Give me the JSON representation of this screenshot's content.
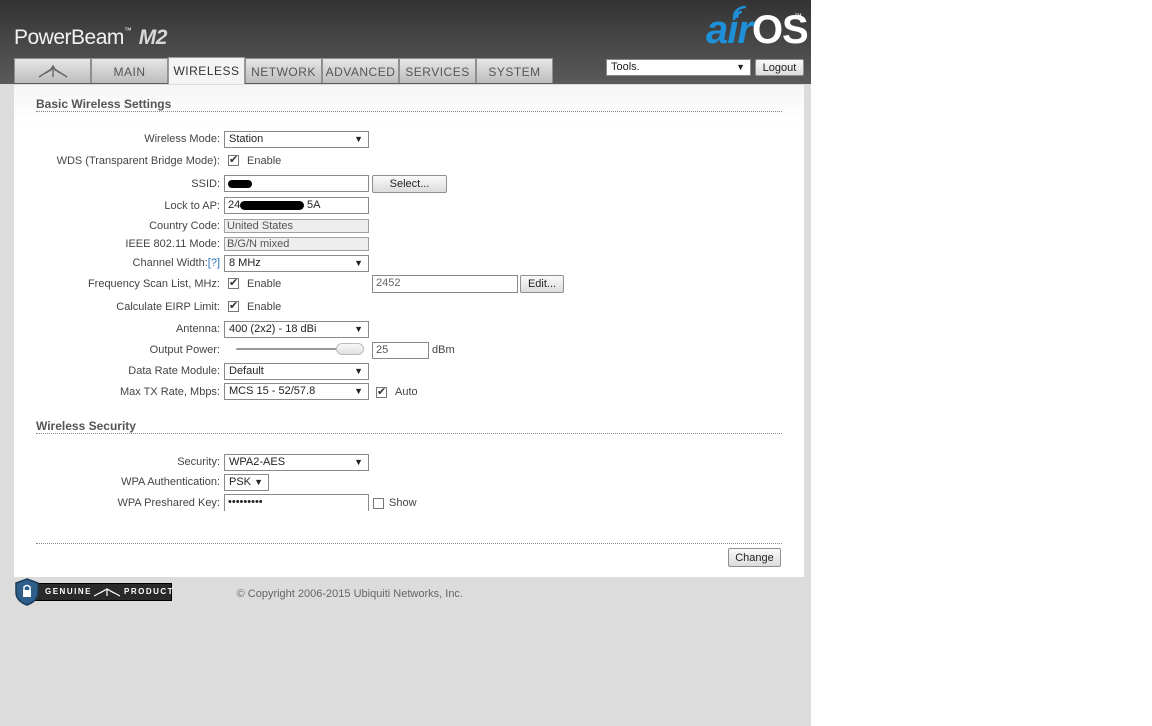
{
  "header": {
    "brand": "PowerBeam",
    "brand_tm": "™",
    "model": "M2",
    "logo_air": "air",
    "logo_os": "OS",
    "logo_tm": "™"
  },
  "tabs": [
    {
      "label": "",
      "icon": "ubiquiti-logo-icon"
    },
    {
      "label": "MAIN"
    },
    {
      "label": "WIRELESS",
      "active": true
    },
    {
      "label": "NETWORK"
    },
    {
      "label": "ADVANCED"
    },
    {
      "label": "SERVICES"
    },
    {
      "label": "SYSTEM"
    }
  ],
  "toolbar": {
    "tools_value": "Tools.",
    "logout_label": "Logout"
  },
  "basic": {
    "title": "Basic Wireless Settings",
    "wireless_mode_label": "Wireless Mode:",
    "wireless_mode_value": "Station",
    "wds_label": "WDS (Transparent Bridge Mode):",
    "wds_enable": "Enable",
    "ssid_label": "SSID:",
    "select_button": "Select...",
    "lock_ap_label": "Lock to AP:",
    "lock_ap_prefix": "24",
    "lock_ap_suffix": "5A",
    "country_label": "Country Code:",
    "country_value": "United States",
    "ieee_label": "IEEE 802.11 Mode:",
    "ieee_value": "B/G/N mixed",
    "channel_width_label": "Channel Width:",
    "channel_width_help": "[?]",
    "channel_width_value": "8 MHz",
    "freq_label": "Frequency Scan List, MHz:",
    "freq_enable": "Enable",
    "freq_value": "2452",
    "edit_button": "Edit...",
    "eirp_label": "Calculate EIRP Limit:",
    "eirp_enable": "Enable",
    "antenna_label": "Antenna:",
    "antenna_value": "400 (2x2) - 18 dBi",
    "output_power_label": "Output Power:",
    "output_power_value": "25",
    "output_power_unit": "dBm",
    "data_rate_label": "Data Rate Module:",
    "data_rate_value": "Default",
    "max_tx_label": "Max TX Rate, Mbps:",
    "max_tx_value": "MCS 15 - 52/57.8",
    "max_tx_auto": "Auto"
  },
  "security": {
    "title": "Wireless Security",
    "security_label": "Security:",
    "security_value": "WPA2-AES",
    "wpa_auth_label": "WPA Authentication:",
    "wpa_auth_value": "PSK",
    "wpa_key_label": "WPA Preshared Key:",
    "wpa_key_value": "•••••••••",
    "show_label": "Show"
  },
  "footer": {
    "change_button": "Change",
    "badge_genuine": "GENUINE",
    "badge_product": "PRODUCT",
    "copyright": "© Copyright 2006-2015 Ubiquiti Networks, Inc."
  },
  "colors": {
    "accent_blue": "#1e90d8",
    "header_dark": "#3a3a3a",
    "panel_bg": "#ffffff"
  }
}
